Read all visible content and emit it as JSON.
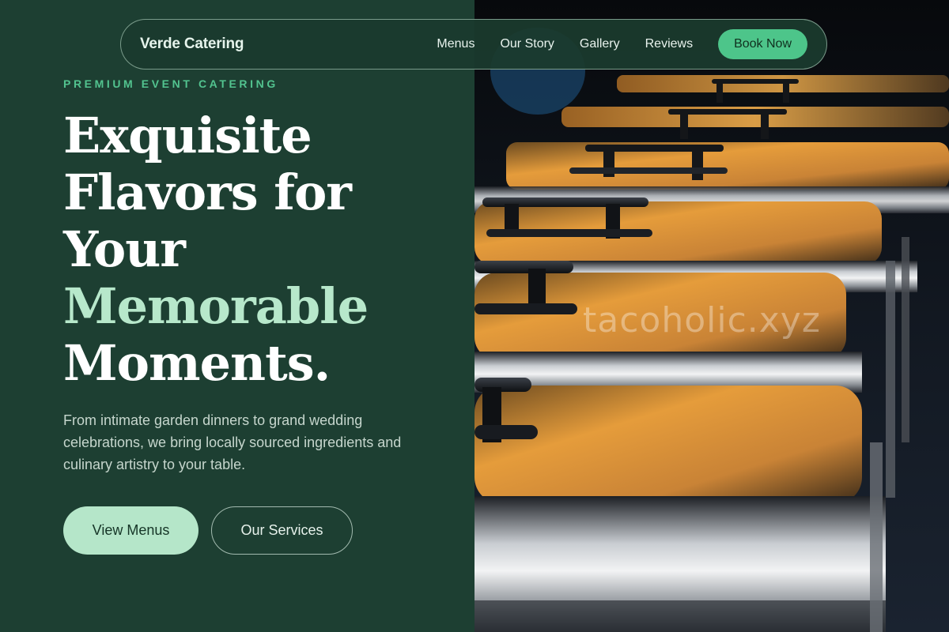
{
  "nav": {
    "brand": "Verde Catering",
    "links": [
      "Menus",
      "Our Story",
      "Gallery",
      "Reviews"
    ],
    "cta": "Book Now"
  },
  "hero": {
    "eyebrow": "PREMIUM EVENT CATERING",
    "headline_lines": [
      "Exquisite",
      "Flavors for",
      "Your",
      "Memorable",
      "Moments."
    ],
    "description": "From intimate garden dinners to grand wedding celebrations, we bring locally sourced ingredients and culinary artistry to your table.",
    "primary_button": "View Menus",
    "secondary_button": "Our Services"
  },
  "image": {
    "subject": "row of stainless steel chafing dishes",
    "watermark": "tacoholic.xyz"
  },
  "colors": {
    "panel_bg": "#1d3f32",
    "accent_green": "#4dc58a",
    "eyebrow_green": "#52c38f",
    "highlight_mint": "#b7e8cb",
    "button_mint": "#b5e6c9"
  }
}
